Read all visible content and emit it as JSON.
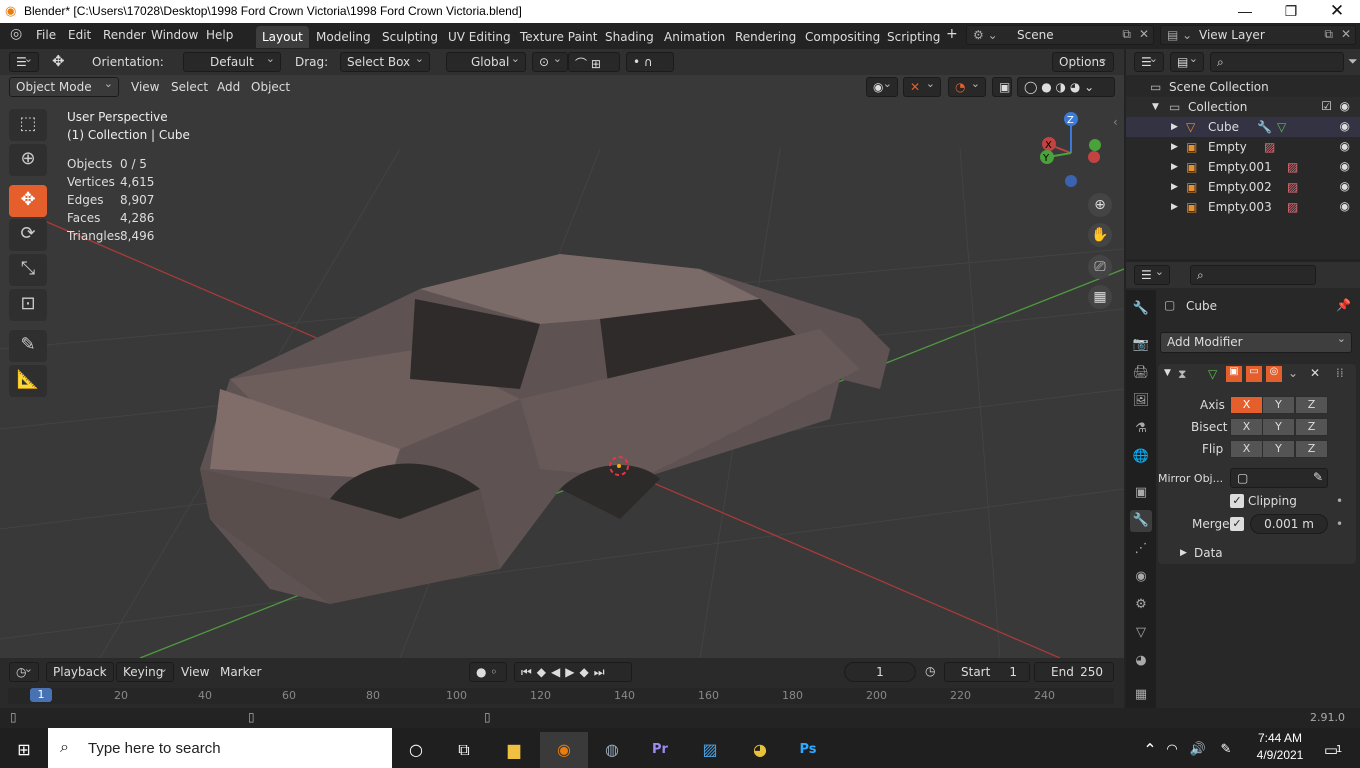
{
  "window": {
    "title": "Blender* [C:\\Users\\17028\\Desktop\\1998 Ford Crown Victoria\\1998 Ford Crown Victoria.blend]"
  },
  "menus": [
    "File",
    "Edit",
    "Render",
    "Window",
    "Help"
  ],
  "workspaces": [
    "Layout",
    "Modeling",
    "Sculpting",
    "UV Editing",
    "Texture Paint",
    "Shading",
    "Animation",
    "Rendering",
    "Compositing",
    "Scripting"
  ],
  "scene": {
    "name": "Scene",
    "view_layer": "View Layer"
  },
  "tool_header": {
    "orientation_label": "Orientation:",
    "orientation_value": "Default",
    "drag_label": "Drag:",
    "drag_value": "Select Box",
    "transform_value": "Global",
    "options": "Options"
  },
  "viewport_header": {
    "mode": "Object Mode",
    "menus": [
      "View",
      "Select",
      "Add",
      "Object"
    ]
  },
  "overlay": {
    "perspective": "User Perspective",
    "collection": "(1) Collection | Cube"
  },
  "stats": [
    {
      "label": "Objects",
      "value": "0 / 5"
    },
    {
      "label": "Vertices",
      "value": "4,615"
    },
    {
      "label": "Edges",
      "value": "8,907"
    },
    {
      "label": "Faces",
      "value": "4,286"
    },
    {
      "label": "Triangles",
      "value": "8,496"
    }
  ],
  "gizmo": {
    "x": "X",
    "y": "Y",
    "z": "Z"
  },
  "outliner": {
    "root": "Scene Collection",
    "collection": "Collection",
    "items": [
      "Cube",
      "Empty",
      "Empty.001",
      "Empty.002",
      "Empty.003"
    ]
  },
  "properties": {
    "object": "Cube",
    "add_modifier": "Add Modifier",
    "axis_label": "Axis",
    "bisect_label": "Bisect",
    "flip_label": "Flip",
    "xyz": [
      "X",
      "Y",
      "Z"
    ],
    "mirror_obj_label": "Mirror Obj...",
    "clipping_label": "Clipping",
    "merge_label": "Merge",
    "merge_value": "0.001 m",
    "data_label": "Data"
  },
  "timeline": {
    "playback": "Playback",
    "keying": "Keying",
    "view": "View",
    "marker": "Marker",
    "current_frame": "1",
    "start_label": "Start",
    "start_value": "1",
    "end_label": "End",
    "end_value": "250",
    "ruler": [
      "1",
      "20",
      "40",
      "60",
      "80",
      "100",
      "120",
      "140",
      "160",
      "180",
      "200",
      "220",
      "240"
    ]
  },
  "status": {
    "version": "2.91.0"
  },
  "taskbar": {
    "search_placeholder": "Type here to search",
    "time": "7:44 AM",
    "date": "4/9/2021",
    "notifications": "1"
  },
  "colors": {
    "accent": "#e45f2b",
    "selection_blue": "#4772b3"
  }
}
